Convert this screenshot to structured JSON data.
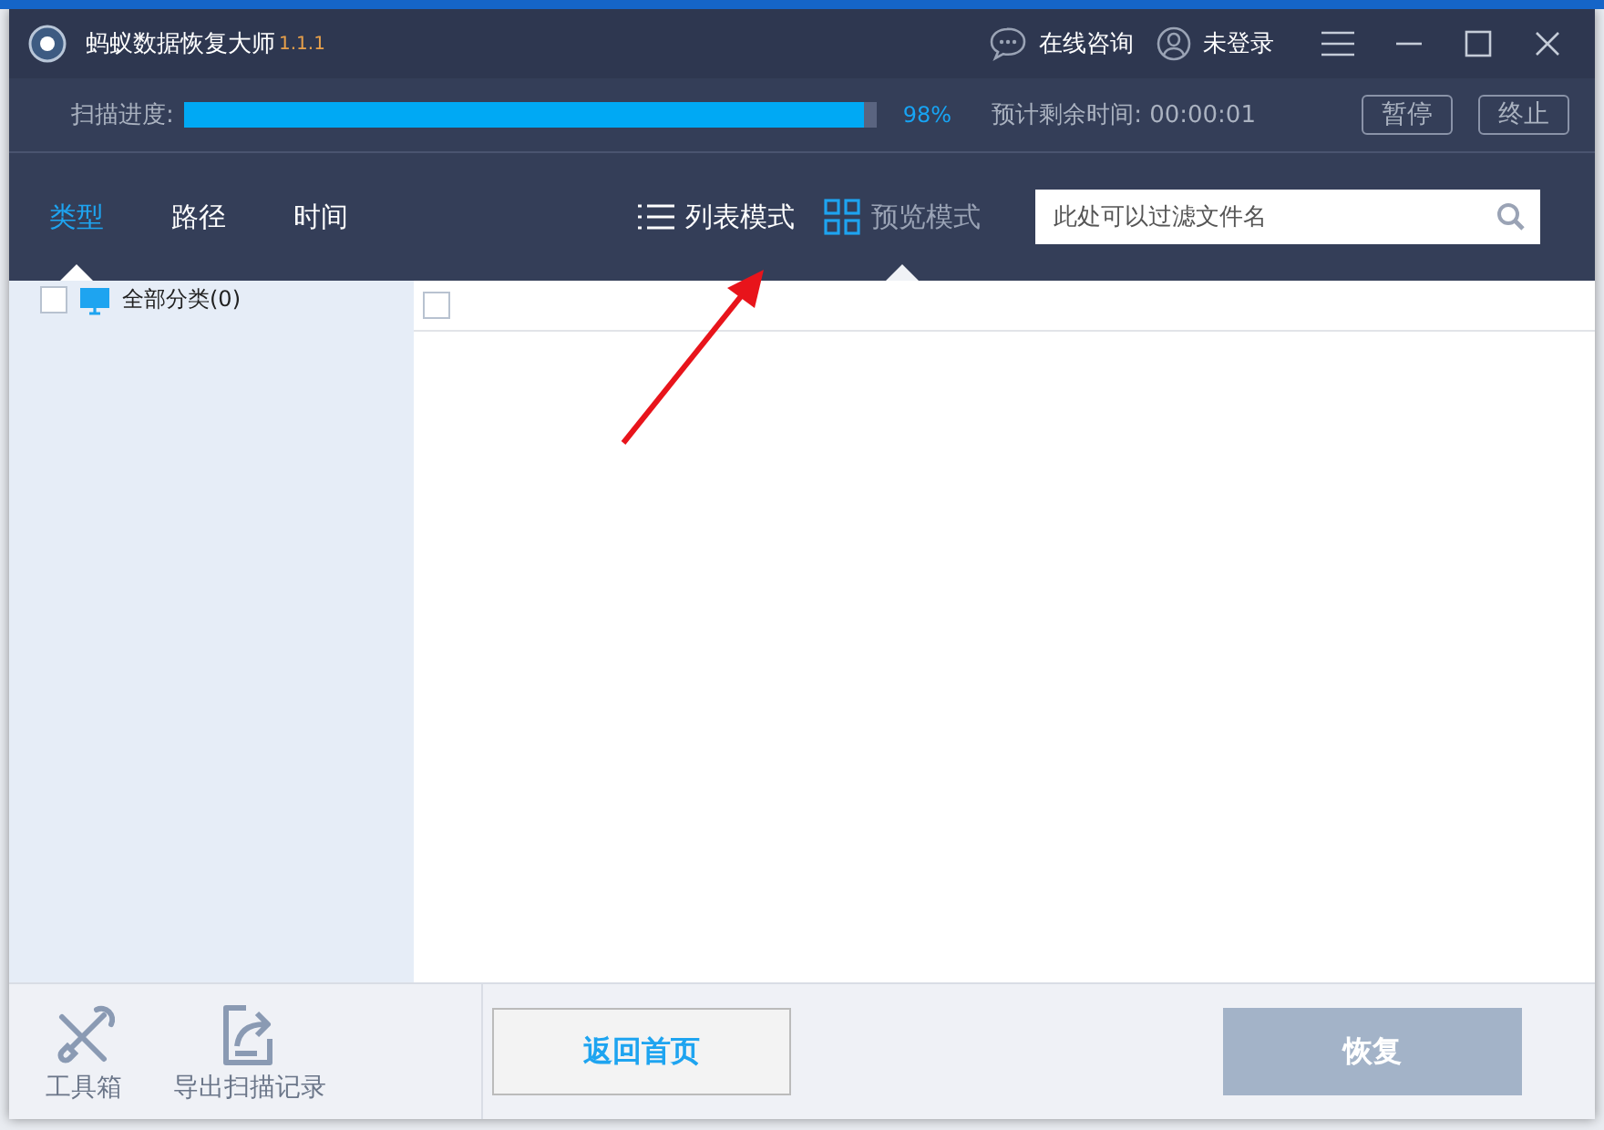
{
  "window": {
    "title": "蚂蚁数据恢复大师",
    "version": "1.1.1",
    "header_links": [
      {
        "label": "在线咨询",
        "kind": "chat"
      },
      {
        "label": "未登录",
        "kind": "user"
      }
    ]
  },
  "scan": {
    "label": "扫描进度:",
    "level": 0.98,
    "percent": "98%",
    "remaining": "预计剩余时间: 00:00:01",
    "buttons": [
      "暂停",
      "终止"
    ]
  },
  "filter_tabs": [
    {
      "label": "类型",
      "selected": true
    },
    {
      "label": "路径",
      "selected": false
    },
    {
      "label": "时间",
      "selected": false
    }
  ],
  "view_modes": [
    {
      "label": "列表模式",
      "kind": "list",
      "selected": false
    },
    {
      "label": "预览模式",
      "kind": "preview",
      "selected": true
    }
  ],
  "search": {
    "placeholder": "此处可以过滤文件名"
  },
  "tree": [
    {
      "label": "全部分类(0)",
      "checked": false
    }
  ],
  "table": {
    "select_all_checked": false
  },
  "footer": {
    "tools": [
      {
        "label": "工具箱",
        "kind": "toolbox"
      },
      {
        "label": "导出扫描记录",
        "kind": "export"
      }
    ],
    "back_button": "返回首页",
    "recover_button": {
      "label": "恢复",
      "disabled": true
    }
  }
}
